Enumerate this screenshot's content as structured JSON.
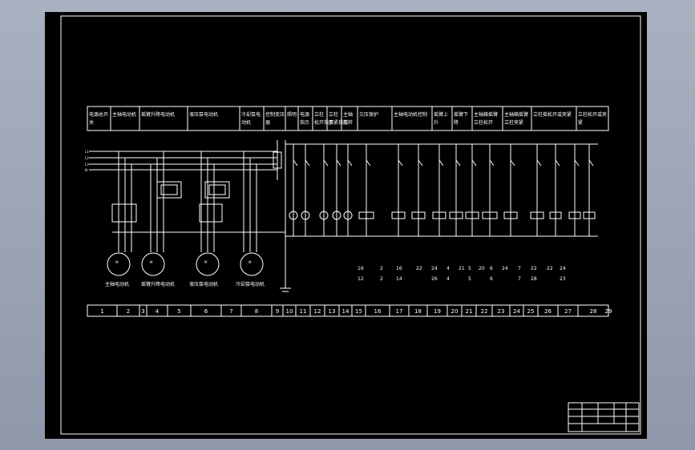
{
  "headers": [
    "电源总开关",
    "主轴电动机",
    "摇臂升降电动机",
    "液压泵电动机",
    "冷却泵电动机",
    "控制变压器",
    "照明",
    "电源指示",
    "立柱松开指示",
    "立柱夹紧指示",
    "主轴旋转",
    "欠压保护",
    "主轴电动机控制",
    "摇臂上升",
    "摇臂下降",
    "主轴箱摇臂立柱松开",
    "主轴箱摇臂立柱夹紧",
    "立柱摇松开或夹紧",
    "立柱松开或夹紧"
  ],
  "motors": [
    "主轴电动机",
    "摇臂升降电动机",
    "液压泵电动机",
    "冷却泵电动机"
  ],
  "columns": [
    "1",
    "2",
    "3",
    "4",
    "5",
    "6",
    "7",
    "8",
    "9",
    "10",
    "11",
    "12",
    "13",
    "14",
    "15",
    "16",
    "17",
    "18",
    "19",
    "20",
    "21",
    "22",
    "23",
    "24",
    "25",
    "26",
    "27",
    "28",
    "29"
  ],
  "contacts": [
    {
      "top": "16",
      "bot": "12"
    },
    {
      "top": "2",
      "bot": "2"
    },
    {
      "top": "16",
      "bot": "14"
    },
    {
      "top": "22",
      "bot": ""
    },
    {
      "top": "24",
      "bot": "26"
    },
    {
      "top": "4",
      "bot": "4"
    },
    {
      "top": "21",
      "bot": ""
    },
    {
      "top": "5",
      "bot": "5"
    },
    {
      "top": "20",
      "bot": ""
    },
    {
      "top": "6",
      "bot": "6"
    },
    {
      "top": "24",
      "bot": ""
    },
    {
      "top": "7",
      "bot": "7"
    },
    {
      "top": "22",
      "bot": "28"
    },
    {
      "top": "22",
      "bot": ""
    },
    {
      "top": "24",
      "bot": "23"
    }
  ],
  "colors": {
    "background": "#000000",
    "line": "#ffffff",
    "window": "#9aa3b4"
  }
}
